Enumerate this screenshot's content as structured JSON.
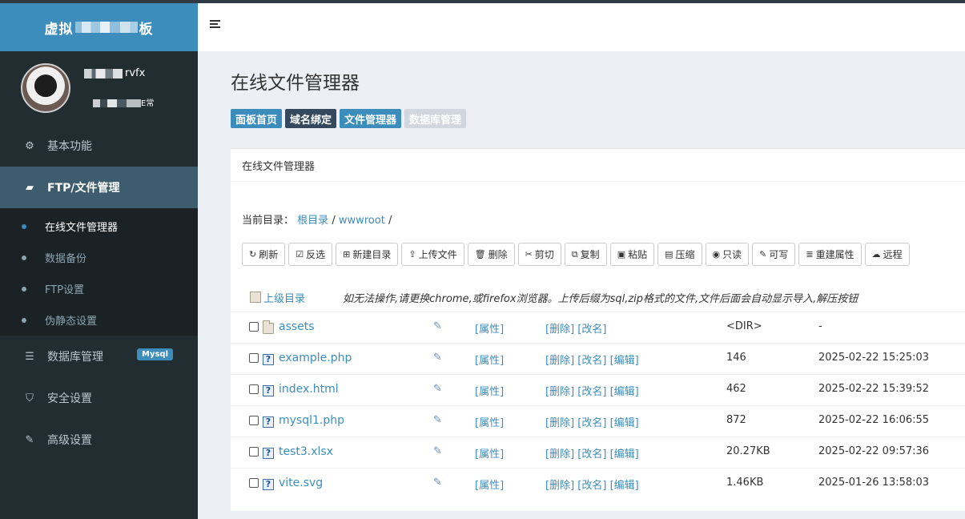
{
  "sidebar": {
    "logo": {
      "left": "虚拟",
      "right": "板"
    },
    "user": {
      "name_suffix": "rvfx",
      "status_suffix": "E常"
    },
    "menu": [
      {
        "label": "基本功能",
        "icon": "gears-icon"
      },
      {
        "label": "FTP/文件管理",
        "icon": "folder-open-icon",
        "active": true
      },
      {
        "label": "数据库管理",
        "icon": "list-icon",
        "badge": "Mysql"
      },
      {
        "label": "安全设置",
        "icon": "shield-icon"
      },
      {
        "label": "高级设置",
        "icon": "edit-icon"
      }
    ],
    "submenu": [
      {
        "label": "在线文件管理器",
        "active": true
      },
      {
        "label": "数据备份"
      },
      {
        "label": "FTP设置"
      },
      {
        "label": "伪静态设置"
      }
    ]
  },
  "page": {
    "title": "在线文件管理器",
    "quick_buttons": [
      "面板首页",
      "域名绑定",
      "文件管理器",
      "数据库管理"
    ],
    "box_title": "在线文件管理器",
    "breadcrumb": {
      "label": "当前目录：",
      "root": "根目录",
      "sep": "/",
      "dir": "wwwroot",
      "trail": "/"
    }
  },
  "toolbar": [
    {
      "label": "刷新",
      "icon": "refresh-icon"
    },
    {
      "label": "反选",
      "icon": "check-square-icon"
    },
    {
      "label": "新建目录",
      "icon": "plus-square-icon"
    },
    {
      "label": "上传文件",
      "icon": "upload-icon"
    },
    {
      "label": "删除",
      "icon": "trash-icon"
    },
    {
      "label": "剪切",
      "icon": "scissors-icon"
    },
    {
      "label": "复制",
      "icon": "copy-icon"
    },
    {
      "label": "粘贴",
      "icon": "paste-icon"
    },
    {
      "label": "压缩",
      "icon": "archive-icon"
    },
    {
      "label": "只读",
      "icon": "eye-icon"
    },
    {
      "label": "可写",
      "icon": "pencil-icon"
    },
    {
      "label": "重建属性",
      "icon": "database-icon"
    },
    {
      "label": "远程",
      "icon": "cloud-download-icon"
    }
  ],
  "files": {
    "up_label": "上级目录",
    "notice": "如无法操作,请更换chrome,或firefox浏览器。上传后缀为sql,zip格式的文件,文件后面会自动显示导入,解压按钮",
    "action_labels": {
      "prop": "[属性]",
      "delete": "[删除]",
      "rename": "[改名]",
      "edit": "[编辑]"
    },
    "rows": [
      {
        "name": "assets",
        "type": "dir",
        "size": "<DIR>",
        "mtime": "-"
      },
      {
        "name": "example.php",
        "type": "file",
        "size": "146",
        "mtime": "2025-02-22 15:25:03"
      },
      {
        "name": "index.html",
        "type": "file",
        "size": "462",
        "mtime": "2025-02-22 15:39:52"
      },
      {
        "name": "mysql1.php",
        "type": "file",
        "size": "872",
        "mtime": "2025-02-22 16:06:55"
      },
      {
        "name": "test3.xlsx",
        "type": "file",
        "size": "20.27KB",
        "mtime": "2025-02-22 09:57:36"
      },
      {
        "name": "vite.svg",
        "type": "file",
        "size": "1.46KB",
        "mtime": "2025-01-26 13:58:03"
      }
    ]
  },
  "colors": {
    "primary": "#3c8dbc",
    "sidebar": "#222d32",
    "active_menu": "#3d5c6e"
  }
}
